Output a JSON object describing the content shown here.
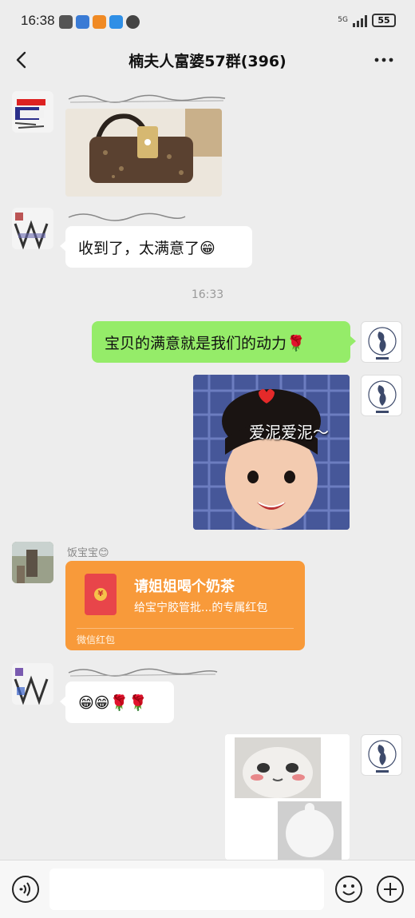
{
  "status_bar": {
    "time": "16:38",
    "network": "5G",
    "battery": "55"
  },
  "header": {
    "title": "楠夫人富婆57群(396)",
    "back_icon": "chevron-left-icon",
    "more_icon": "more-dots-icon"
  },
  "messages": {
    "m2_text": "收到了，太满意了😁",
    "timestamp": "16:33",
    "m3_text": "宝贝的满意就是我们的动力🌹",
    "m4_sticker_text": "爱泥爱泥～",
    "m5_sender": "饭宝宝😊",
    "m5_redpacket_title": "请姐姐喝个奶茶",
    "m5_redpacket_sub": "给宝宁胶管批...的专属红包",
    "m5_redpacket_label": "微信红包",
    "m6_text": "😁😁🌹🌹"
  },
  "input_bar": {
    "voice_icon": "voice-icon",
    "emoji_icon": "emoji-icon",
    "plus_icon": "plus-icon"
  },
  "colors": {
    "background": "#ededed",
    "sent_bubble": "#95ec69",
    "received_bubble": "#ffffff",
    "red_packet": "#f89a3a"
  }
}
